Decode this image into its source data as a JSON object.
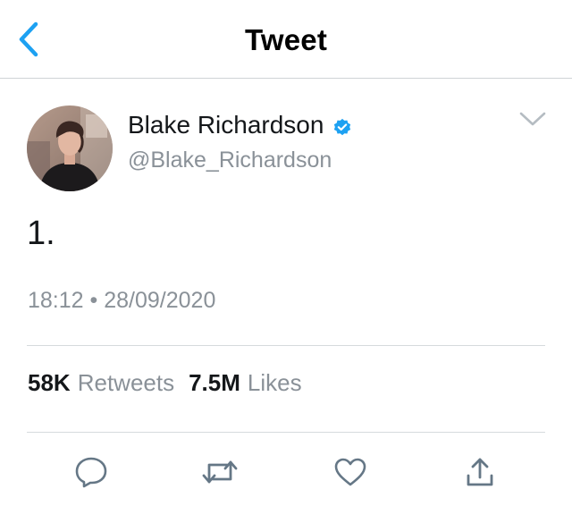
{
  "header": {
    "title": "Tweet",
    "back_icon": "chevron-left-icon"
  },
  "author": {
    "name": "Blake Richardson",
    "handle": "@Blake_Richardson",
    "verified_icon": "verified-badge-icon"
  },
  "tweet": {
    "text": "1.",
    "time": "18:12",
    "separator": "•",
    "date": "28/09/2020"
  },
  "stats": {
    "retweets_count": "58K",
    "retweets_label": "Retweets",
    "likes_count": "7.5M",
    "likes_label": "Likes"
  },
  "actions": [
    "reply-icon",
    "retweet-icon",
    "like-icon",
    "share-icon"
  ],
  "colors": {
    "accent": "#1da1f2",
    "text": "#14171a",
    "secondary": "#8a9198",
    "action_icon": "#657786",
    "divider": "#d6dadd"
  }
}
